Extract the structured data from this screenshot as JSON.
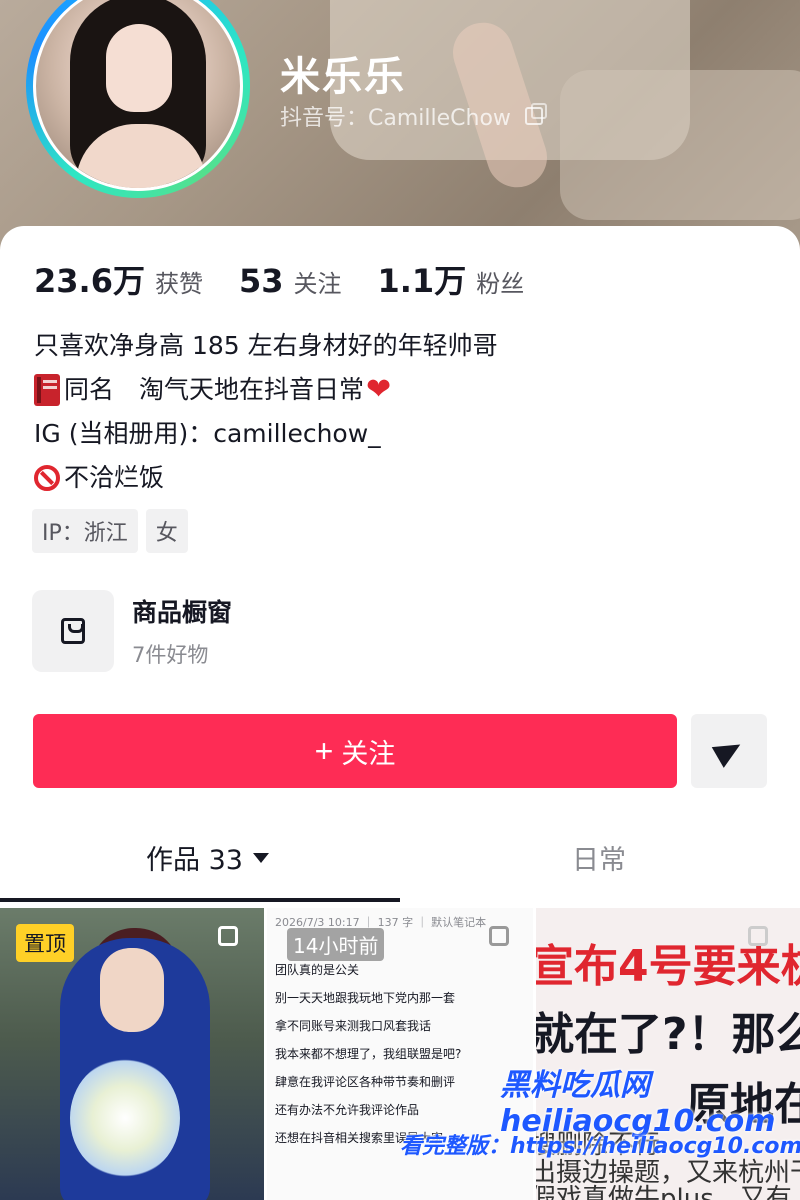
{
  "profile": {
    "name": "米乐乐",
    "douyin_id": "抖音号：CamilleChow"
  },
  "stats": [
    {
      "value": "23.6万",
      "label": "获赞"
    },
    {
      "value": "53",
      "label": "关注"
    },
    {
      "value": "1.1万",
      "label": "粉丝"
    }
  ],
  "bio": {
    "line1": "只喜欢净身高 185 左右身材好的年轻帅哥",
    "line2": "同名　淘气天地在抖音日常",
    "line3": "IG (当相册用)：camillechow_",
    "line4": "不洽烂饭"
  },
  "tags": [
    "IP：浙江",
    "女"
  ],
  "shop": {
    "title": "商品橱窗",
    "subtitle": "7件好物"
  },
  "actions": {
    "follow_label": "关注",
    "follow_plus": "+"
  },
  "tabs": {
    "works": "作品 33",
    "daily": "日常"
  },
  "videos": {
    "pinned_label": "置顶",
    "tile2": {
      "header": "2026/7/3 10:17 ｜ 137 字 ｜ 默认笔记本",
      "time_overlay": "14小时前",
      "lines": [
        "团队真的是公关",
        "别一天天地跟我玩地下党内那一套",
        "拿不同账号来测我口风套我话",
        "",
        "我本来都不想理了，我组联盟是吧?",
        "",
        "肆意在我评论区各种带节奏和删评",
        "还有办法不允许我评论作品",
        "还想在抖音相关搜索里误导大家"
      ]
    },
    "tile3": {
      "line1": "宣布4号要来杭",
      "line2": "就在了?！那么",
      "line3": "原地在",
      "line4": "搜删除不行",
      "line5": "出摄边操题，又来杭州干",
      "line6": "假戏真做牛plus，又有"
    }
  },
  "watermark": {
    "brand": "黑料吃瓜网 heiliaocg10.com",
    "note": "看完整版：https://heiliaocg10.com"
  }
}
